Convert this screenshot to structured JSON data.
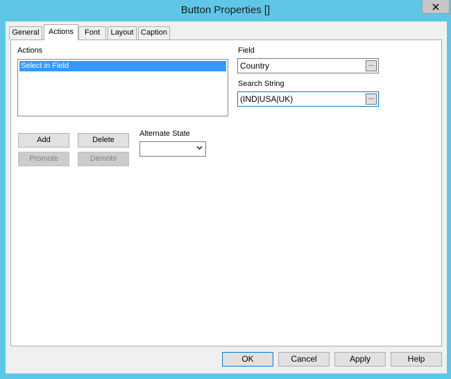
{
  "window": {
    "title": "Button Properties []"
  },
  "tabs": [
    {
      "label": "General",
      "active": false
    },
    {
      "label": "Actions",
      "active": true
    },
    {
      "label": "Font",
      "active": false
    },
    {
      "label": "Layout",
      "active": false
    },
    {
      "label": "Caption",
      "active": false
    }
  ],
  "actions": {
    "label": "Actions",
    "items": [
      "Select in Field"
    ],
    "selected_index": 0,
    "add_label": "Add",
    "delete_label": "Delete",
    "promote_label": "Promote",
    "demote_label": "Demote",
    "promote_enabled": false,
    "demote_enabled": false
  },
  "alternate_state": {
    "label": "Alternate State",
    "value": ""
  },
  "field": {
    "label": "Field",
    "value": "Country",
    "browse_label": "..."
  },
  "search_string": {
    "label": "Search String",
    "value": "(IND|USA|UK)",
    "browse_label": "..."
  },
  "footer": {
    "ok_label": "OK",
    "cancel_label": "Cancel",
    "apply_label": "Apply",
    "help_label": "Help"
  },
  "icons": {
    "close": "close-icon",
    "dropdown": "chevron-down-icon"
  },
  "colors": {
    "title_bar": "#5fc6e8",
    "selection": "#3399ff",
    "focus_border": "#0078d7"
  }
}
